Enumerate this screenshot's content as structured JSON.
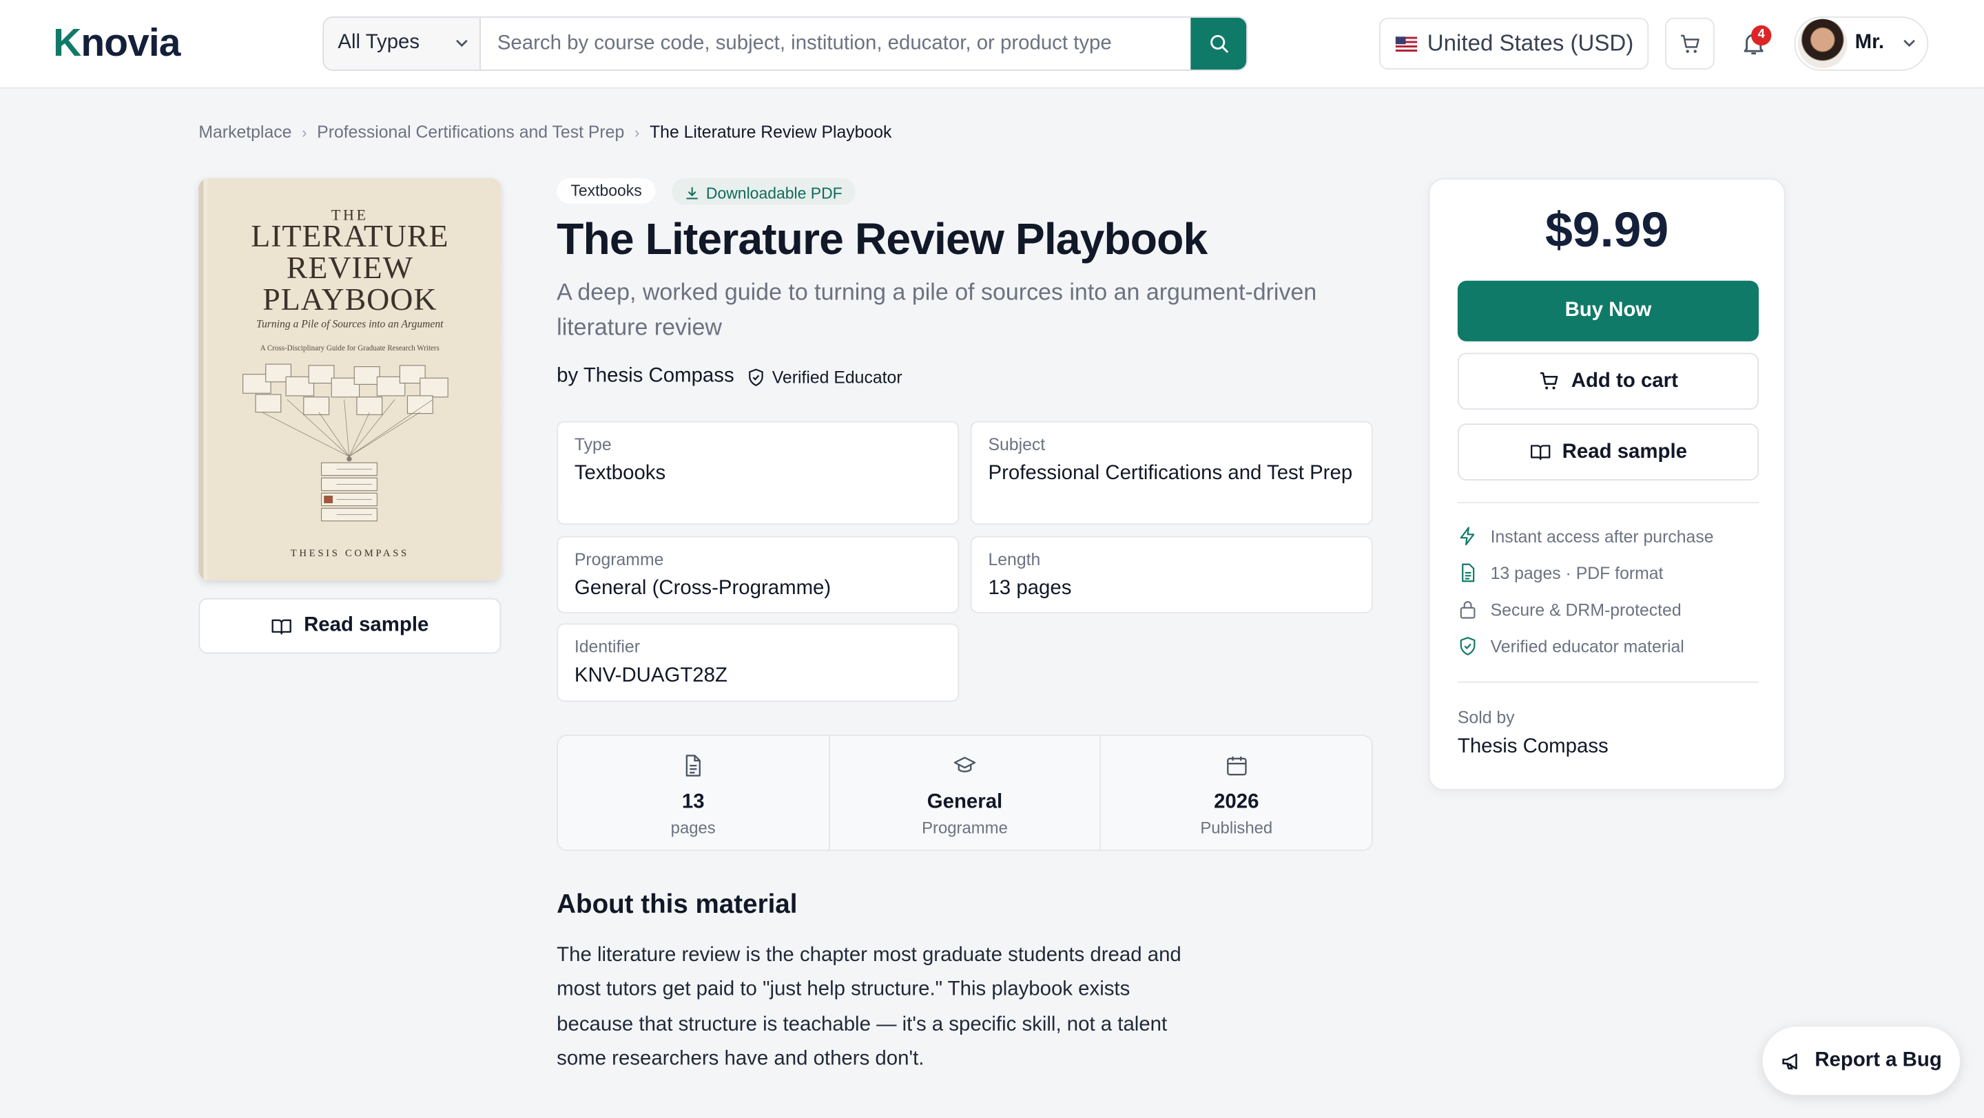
{
  "header": {
    "logo": "Knovia",
    "type_select": "All Types",
    "search_placeholder": "Search by course code, subject, institution, educator, or product type",
    "currency": "United States (USD)",
    "notification_count": "4",
    "user_name": "Mr."
  },
  "breadcrumb": [
    "Marketplace",
    "Professional Certifications and Test Prep",
    "The Literature Review Playbook"
  ],
  "cover": {
    "the": "THE",
    "title_lines": [
      "LITERATURE",
      "REVIEW",
      "PLAYBOOK"
    ],
    "subtitle": "Turning a Pile of Sources into an Argument",
    "subtitle2": "A Cross-Disciplinary Guide for Graduate Research Writers",
    "author": "THESIS COMPASS"
  },
  "read_sample_label": "Read sample",
  "product": {
    "tag_type": "Textbooks",
    "tag_pdf": "Downloadable PDF",
    "title": "The Literature Review Playbook",
    "subtitle": "A deep, worked guide to turning a pile of sources into an argument-driven literature review",
    "by": "by Thesis Compass",
    "verified": "Verified Educator"
  },
  "fields": {
    "type": {
      "label": "Type",
      "value": "Textbooks"
    },
    "subject": {
      "label": "Subject",
      "value": "Professional Certifications and Test Prep"
    },
    "programme": {
      "label": "Programme",
      "value": "General (Cross-Programme)"
    },
    "length": {
      "label": "Length",
      "value": "13 pages"
    },
    "identifier": {
      "label": "Identifier",
      "value": "KNV-DUAGT28Z"
    }
  },
  "stats": [
    {
      "num": "13",
      "cap": "pages"
    },
    {
      "num": "General",
      "cap": "Programme"
    },
    {
      "num": "2026",
      "cap": "Published"
    }
  ],
  "about": {
    "heading": "About this material",
    "body": "The literature review is the chapter most graduate students dread and most tutors get paid to \"just help structure.\" This playbook exists because that structure is teachable — it's a specific skill, not a talent some researchers have and others don't."
  },
  "purchase": {
    "price": "$9.99",
    "buy_now": "Buy Now",
    "add_to_cart": "Add to cart",
    "read_sample": "Read sample",
    "features": [
      "Instant access after purchase",
      "13 pages · PDF format",
      "Secure & DRM-protected",
      "Verified educator material"
    ],
    "sold_by_label": "Sold by",
    "sold_by": "Thesis Compass"
  },
  "report_bug": "Report a Bug",
  "colors": {
    "accent": "#0f7a68",
    "notification": "#dc2626"
  }
}
